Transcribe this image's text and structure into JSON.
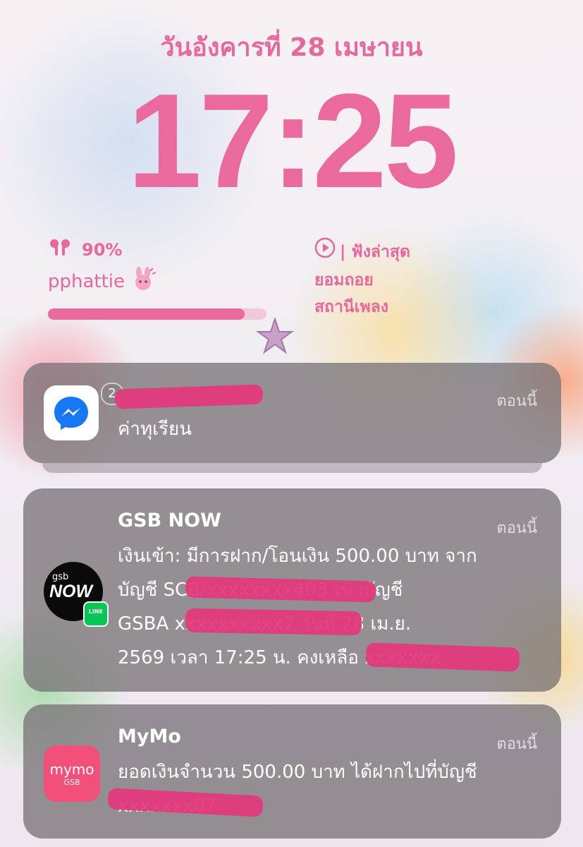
{
  "lockscreen": {
    "date": "วันอังคารที่ 28 เมษายน",
    "time": "17:25"
  },
  "battery_widget": {
    "percent_text": "90%",
    "device_name": "pphattie",
    "level": 0.9
  },
  "music_widget": {
    "header": "| ฟังล่าสุด",
    "track": "ยอมถอย",
    "station": "สถานีเพลง"
  },
  "notifications": [
    {
      "app": "Messenger",
      "badge": "2",
      "time": "ตอนนี้",
      "message": "ค่าทุเรียน"
    },
    {
      "app": "GSB NOW",
      "title": "GSB NOW",
      "time": "ตอนนี้",
      "lines": [
        "เงินเข้า: มีการฝาก/โอนเงิน 500.00 บาท จาก",
        "บัญชี SCB/xxxxxxxx403 เข้าบัญชี",
        "GSBA xxxxxxxxxx7 วันที่ 28 เม.ย.",
        "2569 เวลา 17:25 น. คงเหลือ xxxxxxx"
      ],
      "icon_text_top": "gsb",
      "icon_text_main": "NOW",
      "line_badge": "LINE"
    },
    {
      "app": "MyMo",
      "title": "MyMo",
      "time": "ตอนนี้",
      "lines": [
        "ยอดเงินจำนวน 500.00 บาท ได้ฝากไปที่บัญชี",
        "xxxxxxx07"
      ],
      "icon_text_main": "mymo",
      "icon_text_sub": "GSB"
    }
  ],
  "colors": {
    "accent_pink": "#ea6a9e",
    "messenger_blue": "#1877f2",
    "mymo_pink": "#f0507a",
    "redaction": "#e23a7c"
  }
}
